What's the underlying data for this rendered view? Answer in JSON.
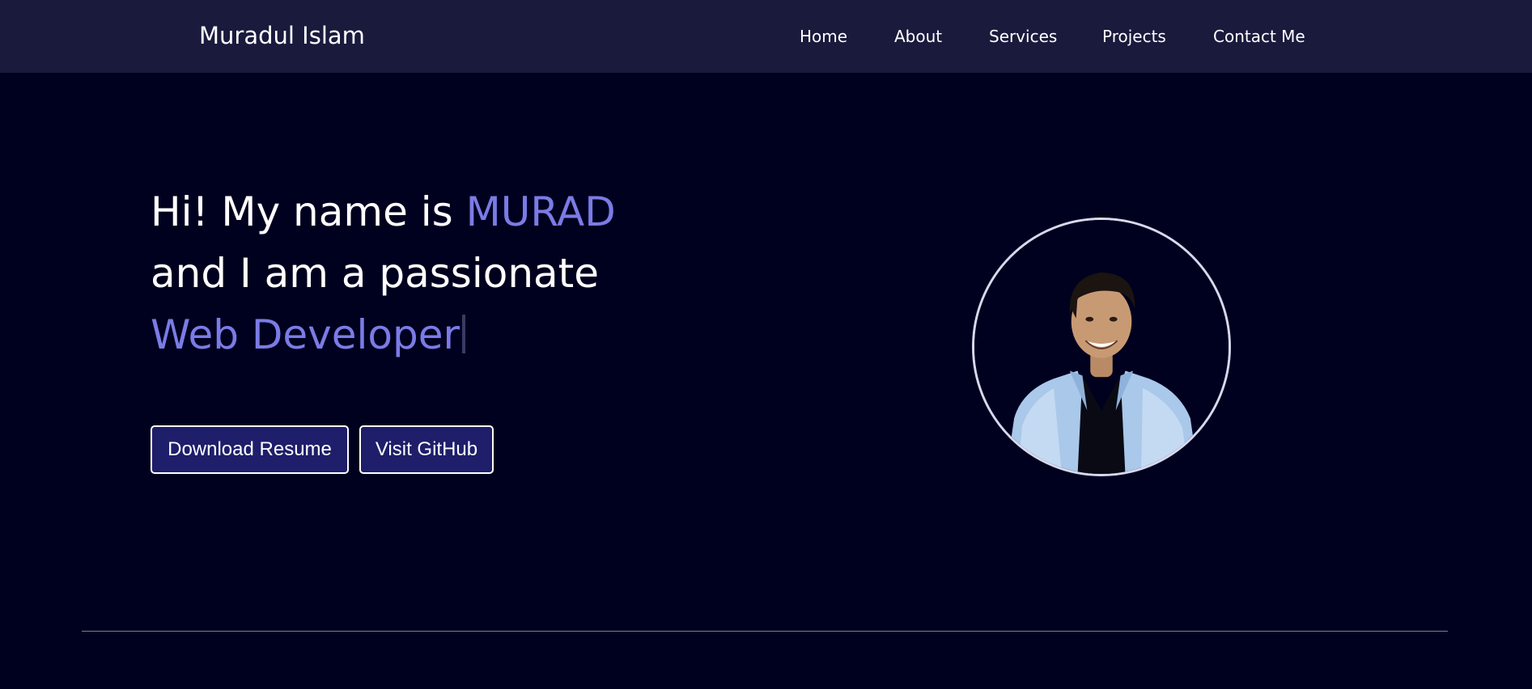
{
  "header": {
    "brand": "Muradul Islam",
    "nav": [
      {
        "label": "Home"
      },
      {
        "label": "About"
      },
      {
        "label": "Services"
      },
      {
        "label": "Projects"
      },
      {
        "label": "Contact Me"
      }
    ]
  },
  "hero": {
    "line1_prefix": "Hi! My name is ",
    "line1_name": "MURAD",
    "line2": "and I am a passionate",
    "line3_role": "Web Developer",
    "buttons": {
      "resume": "Download Resume",
      "github": "Visit GitHub"
    },
    "accent_color": "#7b7be6"
  },
  "colors": {
    "background": "#00001f",
    "navbar": "#1a1a3d",
    "button_bg": "#1e1e6b"
  }
}
